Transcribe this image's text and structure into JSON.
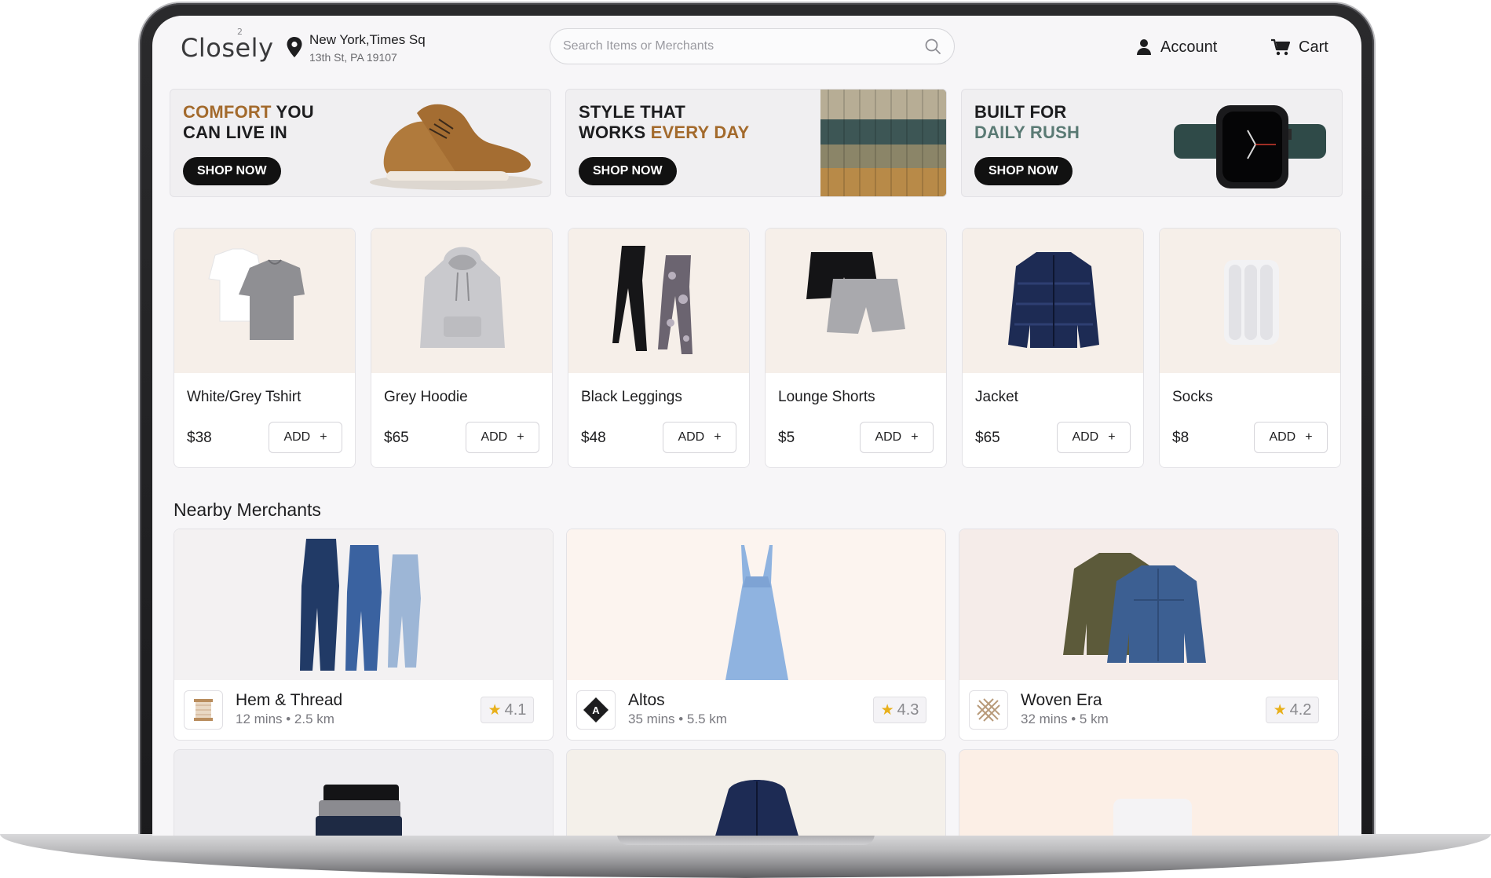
{
  "app": {
    "logo": "Closely",
    "logo_sup": "2"
  },
  "location": {
    "line1": "New York,Times Sq",
    "line2": "13th St,  PA 19107"
  },
  "search": {
    "placeholder": "Search Items or Merchants"
  },
  "header": {
    "account_label": "Account",
    "cart_label": "Cart"
  },
  "banners": [
    {
      "title_accent": "COMFORT",
      "title_rest": " YOU",
      "title_line2": "CAN LIVE IN",
      "button": "SHOP NOW"
    },
    {
      "title_line1": "STYLE THAT",
      "title_line2_prefix": "WORKS ",
      "title_line2_accent": "EVERY DAY",
      "button": "SHOP NOW"
    },
    {
      "title_line1": "BUILT FOR",
      "title_line2_accent": "DAILY RUSH",
      "button": "SHOP NOW"
    }
  ],
  "products": [
    {
      "name": "White/Grey Tshirt",
      "price": "$38",
      "add_label": "ADD"
    },
    {
      "name": "Grey Hoodie",
      "price": "$65",
      "add_label": "ADD"
    },
    {
      "name": "Black Leggings",
      "price": "$48",
      "add_label": "ADD"
    },
    {
      "name": "Lounge Shorts",
      "price": "$5",
      "add_label": "ADD"
    },
    {
      "name": "Jacket",
      "price": "$65",
      "add_label": "ADD"
    },
    {
      "name": "Socks",
      "price": "$8",
      "add_label": "ADD"
    }
  ],
  "merchants_section": {
    "title": "Nearby Merchants"
  },
  "merchants": [
    {
      "name": "Hem & Thread",
      "meta": "12 mins • 2.5 km",
      "rating": "4.1"
    },
    {
      "name": "Altos",
      "meta": "35 mins • 5.5 km",
      "rating": "4.3"
    },
    {
      "name": "Woven Era",
      "meta": "32 mins • 5 km",
      "rating": "4.2"
    }
  ],
  "colors": {
    "accent_brown": "#a36a2c",
    "accent_green": "#5a7a74",
    "star": "#e8b01b",
    "button_dark": "#111111"
  },
  "icons": [
    "location-pin-icon",
    "search-icon",
    "user-icon",
    "cart-icon",
    "plus-icon",
    "star-icon"
  ]
}
